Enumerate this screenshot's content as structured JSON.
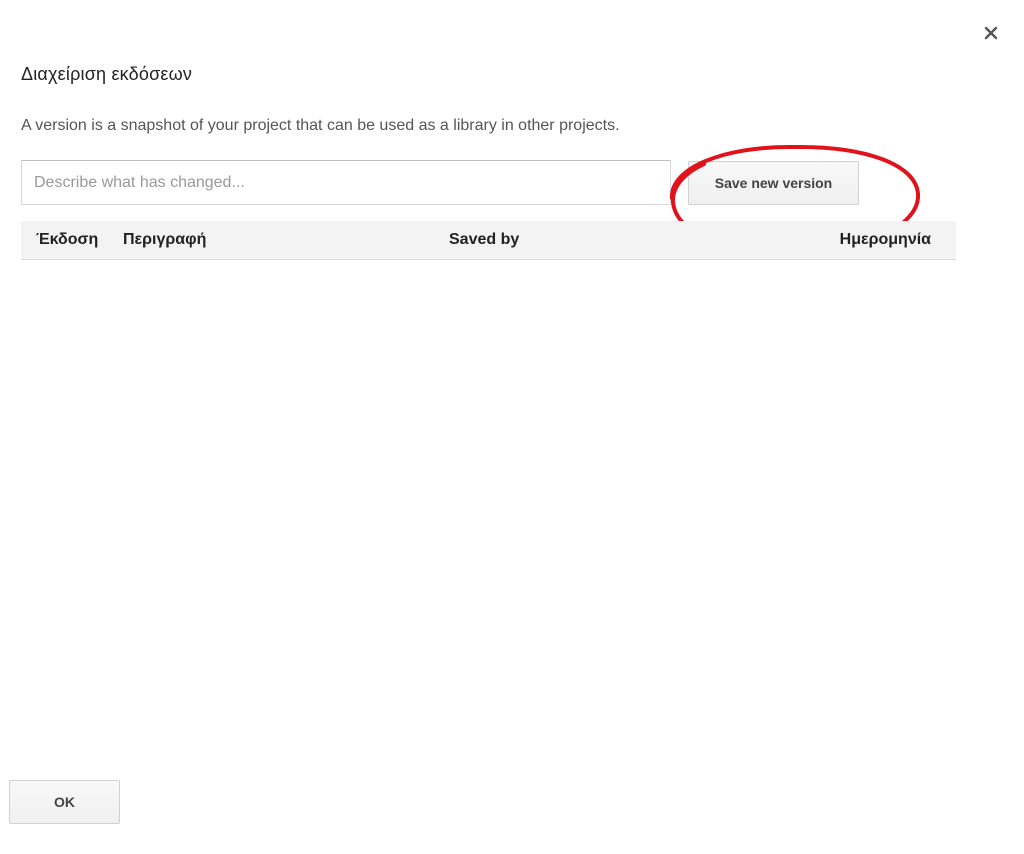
{
  "dialog": {
    "title": "Διαχείριση εκδόσεων",
    "description": "A version is a snapshot of your project that can be used as a library in other projects.",
    "close_icon": "close-icon"
  },
  "form": {
    "description_input": {
      "placeholder": "Describe what has changed...",
      "value": ""
    },
    "save_label": "Save new version"
  },
  "table": {
    "columns": [
      "Έκδοση",
      "Περιγραφή",
      "Saved by",
      "Ημερομηνία"
    ],
    "rows": []
  },
  "footer": {
    "ok_label": "OK"
  },
  "annotation": {
    "shape": "ellipse",
    "color": "#e0121c",
    "target": "save-new-version-button"
  }
}
